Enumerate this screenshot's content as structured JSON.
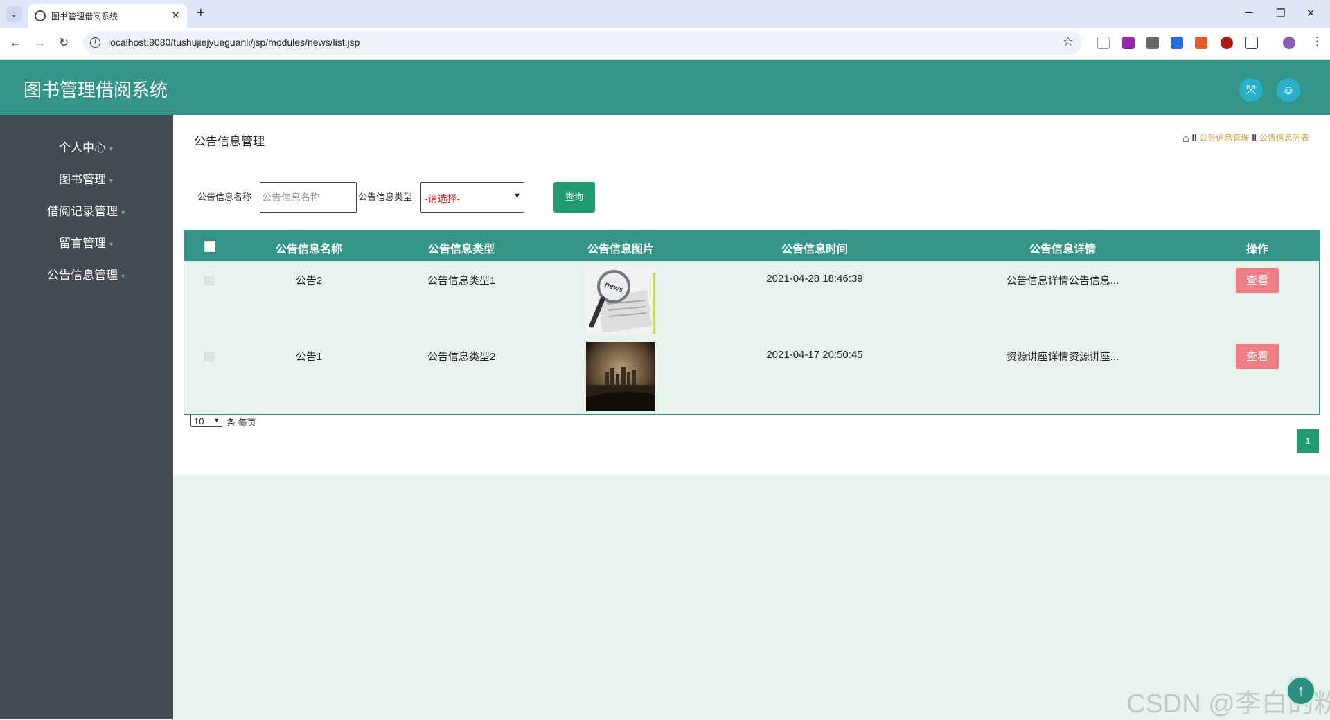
{
  "browser": {
    "tab_title": "图书管理借阅系统",
    "url": "localhost:8080/tushujiejyueguanli/jsp/modules/news/list.jsp"
  },
  "header": {
    "title": "图书管理借阅系统"
  },
  "sidebar": {
    "items": [
      {
        "label": "个人中心"
      },
      {
        "label": "图书管理"
      },
      {
        "label": "借阅记录管理"
      },
      {
        "label": "留言管理"
      },
      {
        "label": "公告信息管理"
      }
    ]
  },
  "page": {
    "title": "公告信息管理",
    "breadcrumb": [
      "公告信息管理",
      "公告信息列表"
    ]
  },
  "search": {
    "name_label": "公告信息名称",
    "name_placeholder": "公告信息名称",
    "type_label": "公告信息类型",
    "type_selected": "-请选择-",
    "query_label": "查询"
  },
  "table": {
    "columns": [
      "公告信息名称",
      "公告信息类型",
      "公告信息图片",
      "公告信息时间",
      "公告信息详情",
      "操作"
    ],
    "rows": [
      {
        "name": "公告2",
        "type": "公告信息类型1",
        "image": "news-magnifier-thumbnail",
        "time": "2021-04-28 18:46:39",
        "detail": "公告信息详情公告信息...",
        "action": "查看"
      },
      {
        "name": "公告1",
        "type": "公告信息类型2",
        "image": "city-skyline-thumbnail",
        "time": "2021-04-17 20:50:45",
        "detail": "资源讲座详情资源讲座...",
        "action": "查看"
      }
    ]
  },
  "pagination": {
    "page_size": "10",
    "page_size_label": "条 每页",
    "current_page": "1"
  },
  "watermark": "CSDN @李白的粉",
  "colors": {
    "header": "#339488",
    "sidebar": "#434b52",
    "button": "#1f9b6f",
    "view_button": "#ef7f85",
    "breadcrumb": "#c9a24a"
  }
}
